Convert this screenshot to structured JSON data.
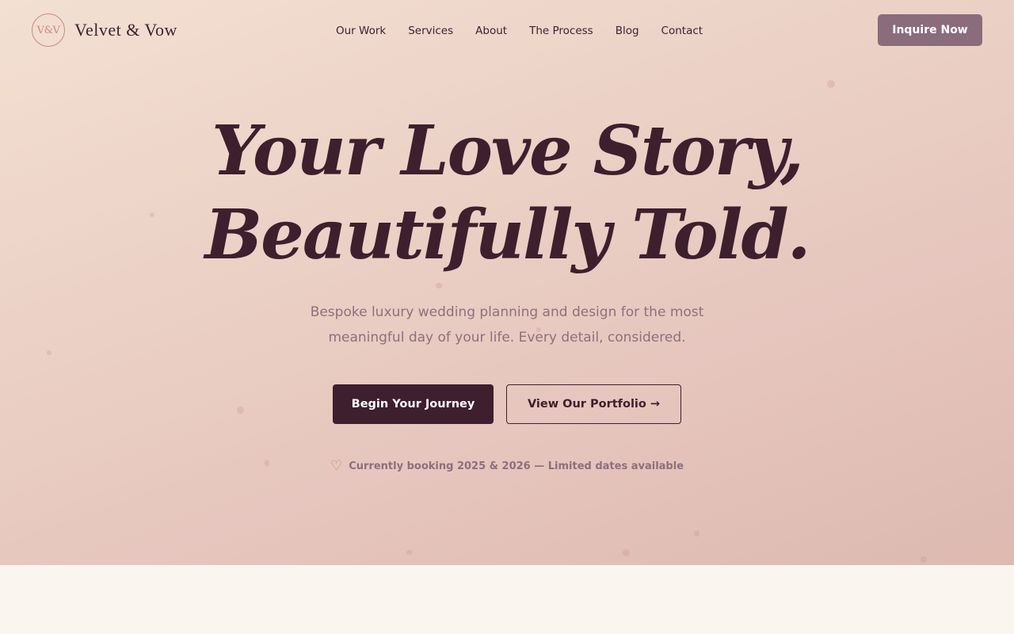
{
  "brand": {
    "monogram": "V&V",
    "name": "Velvet & Vow"
  },
  "nav": {
    "items": [
      {
        "label": "Our Work"
      },
      {
        "label": "Services"
      },
      {
        "label": "About"
      },
      {
        "label": "The Process"
      },
      {
        "label": "Blog"
      },
      {
        "label": "Contact"
      }
    ]
  },
  "header": {
    "cta_label": "Inquire Now"
  },
  "hero": {
    "headline_line1": "Your Love Story,",
    "headline_line2": "Beautifully Told.",
    "subtitle": "Bespoke luxury wedding planning and design for the most meaningful day of your life. Every detail, considered.",
    "primary_button": "Begin Your Journey",
    "secondary_button": "View Our Portfolio →",
    "booking_icon": "heart-icon",
    "booking_text": "Currently booking 2025 & 2026 — Limited dates available"
  },
  "colors": {
    "accent_dark": "#3d1f2e",
    "accent_mauve": "#8a6c7c",
    "accent_rose": "#c98a7f",
    "hero_gradient_start": "#f3e0d2",
    "hero_gradient_end": "#ddb9b0",
    "page_background": "#faf5ef"
  }
}
